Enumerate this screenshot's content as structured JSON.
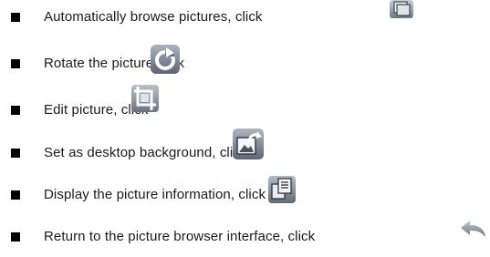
{
  "items": [
    {
      "text": "Automatically browse pictures, click",
      "icon": "slideshow-icon"
    },
    {
      "text": "Rotate the picture,click",
      "icon": "rotate-icon"
    },
    {
      "text": "Edit picture,  click",
      "icon": "crop-edit-icon"
    },
    {
      "text": "Set as desktop background, click",
      "icon": "set-wallpaper-icon"
    },
    {
      "text": "Display the picture information, click",
      "icon": "picture-info-icon"
    },
    {
      "text": "Return to the picture browser interface, click",
      "icon": "return-back-icon"
    }
  ]
}
